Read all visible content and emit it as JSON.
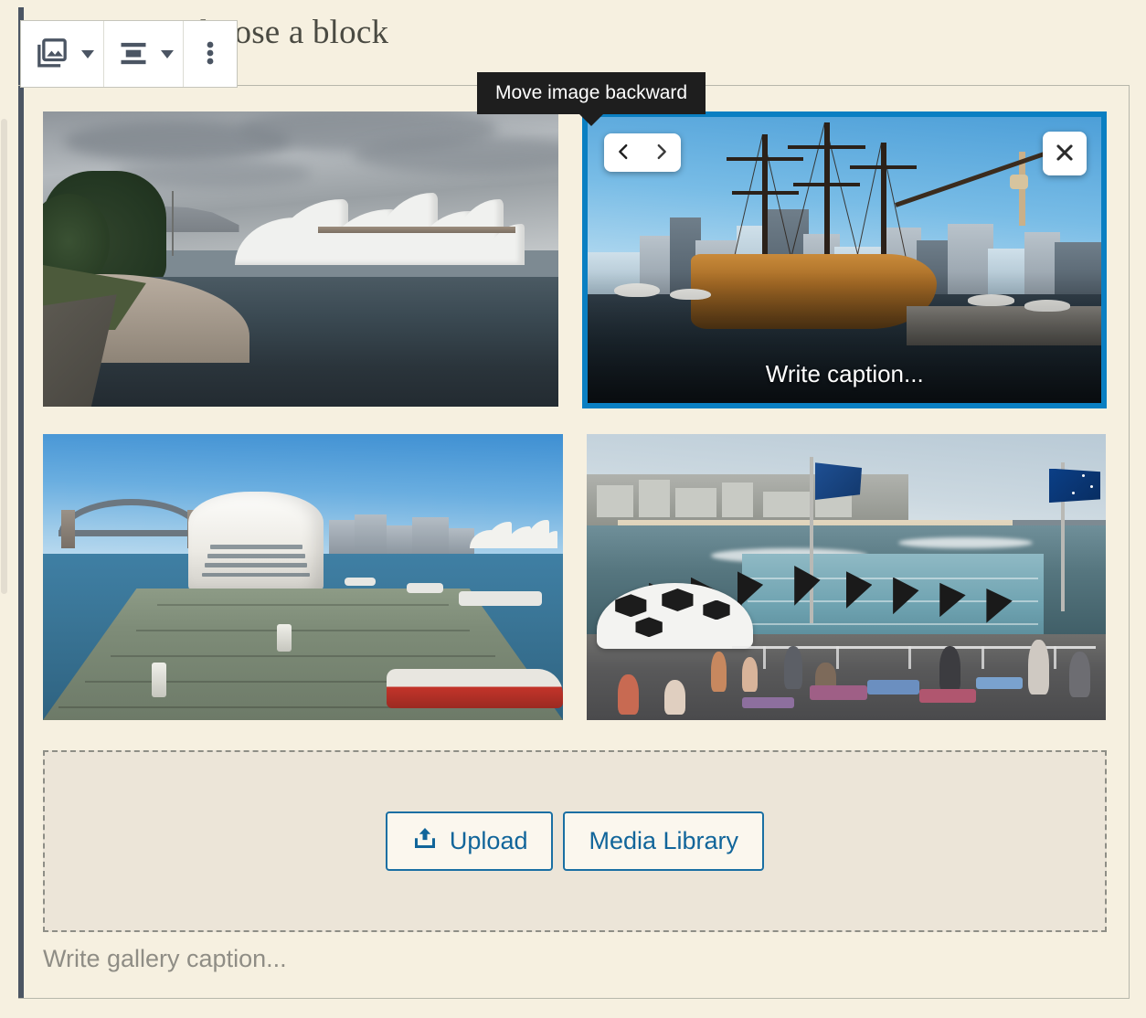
{
  "editor": {
    "placeholder_paragraph": "r type / to choose a block",
    "background_color": "#f6f0e0",
    "accent_color": "#0a7fc2"
  },
  "toolbar": {
    "buttons": [
      {
        "name": "gallery-block-type",
        "icon": "gallery-icon",
        "has_caret": true
      },
      {
        "name": "align-block",
        "icon": "align-center-icon",
        "has_caret": true
      },
      {
        "name": "more-options",
        "icon": "three-dots-vertical-icon",
        "has_caret": false
      }
    ]
  },
  "tooltip": {
    "text": "Move image backward"
  },
  "gallery": {
    "images": [
      {
        "index": 0,
        "alt": "Sydney Opera House seen across the harbour on an overcast day",
        "selected": false,
        "caption": ""
      },
      {
        "index": 1,
        "alt": "Tall ship replica moored at Darling Harbour with city skyline",
        "selected": true,
        "caption_placeholder": "Write caption...",
        "controls": {
          "move_backward": "chevron-left-icon",
          "move_forward": "chevron-right-icon",
          "remove": "close-x-icon"
        }
      },
      {
        "index": 2,
        "alt": "Cruise ship berthed at Circular Quay with Harbour Bridge and Opera House",
        "selected": false,
        "caption": ""
      },
      {
        "index": 3,
        "alt": "Bondi Icebergs ocean pool with flags and beachgoers",
        "selected": false,
        "caption": ""
      }
    ],
    "caption_placeholder": "Write gallery caption..."
  },
  "dropzone": {
    "upload_label": "Upload",
    "upload_icon": "upload-icon",
    "media_library_label": "Media Library"
  }
}
